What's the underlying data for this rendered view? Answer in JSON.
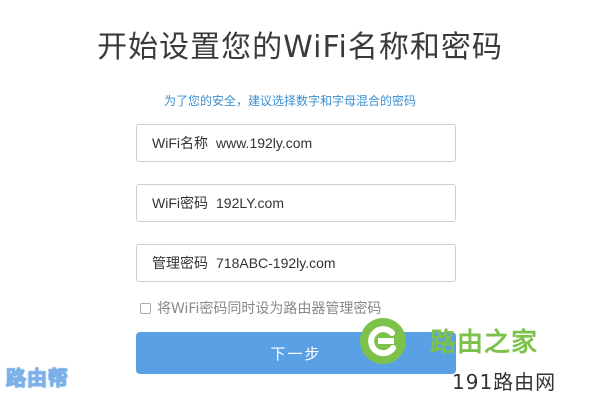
{
  "page": {
    "title": "开始设置您的WiFi名称和密码",
    "hint": "为了您的安全，建议选择数字和字母混合的密码"
  },
  "fields": [
    {
      "label": "WiFi名称",
      "value": "www.192ly.com"
    },
    {
      "label": "WiFi密码",
      "value": "192LY.com"
    },
    {
      "label": "管理密码",
      "value": "718ABC-192ly.com"
    }
  ],
  "options": {
    "same_password_label": "将WiFi密码同时设为路由器管理密码",
    "same_password_checked": false
  },
  "buttons": {
    "next_label": "下一步"
  },
  "colors": {
    "accent": "#5aa0e4",
    "hint": "#3c8fd0",
    "watermark_green": "#7cc24a"
  },
  "watermarks": {
    "left_text": "路由帮",
    "right_brand": "路由之家",
    "right_url": "191路由网"
  }
}
